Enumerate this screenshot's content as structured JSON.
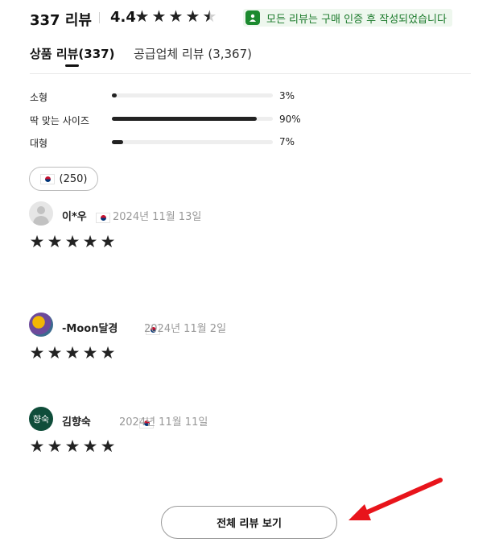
{
  "header": {
    "review_count_label": "337 리뷰",
    "rating": "4.4",
    "star_rating": 4.5,
    "verified_notice": "모든 리뷰는 구매 인증 후 작성되었습니다"
  },
  "tabs": [
    {
      "label": "상품 리뷰(337)",
      "active": true
    },
    {
      "label": "공급업체 리뷰 (3,367)",
      "active": false
    }
  ],
  "fit": [
    {
      "label": "소형",
      "percent": 3,
      "percent_label": "3%"
    },
    {
      "label": "딱 맞는 사이즈",
      "percent": 90,
      "percent_label": "90%"
    },
    {
      "label": "대형",
      "percent": 7,
      "percent_label": "7%"
    }
  ],
  "country_filter": {
    "flag": "south-korea-flag-icon",
    "count": "(250)"
  },
  "reviews": [
    {
      "name": "이*우",
      "date": "2024년 11월 13일",
      "stars": 5,
      "avatar": "default-avatar"
    },
    {
      "name": "-Moon달경",
      "date": "2024년 11월 2일",
      "stars": 5,
      "avatar": "photo-avatar"
    },
    {
      "name": "김향숙",
      "date": "2024년 11월 11일",
      "stars": 5,
      "avatar": "text-avatar",
      "avatar_text": "향숙"
    }
  ],
  "view_all_label": "전체 리뷰 보기",
  "colors": {
    "star": "#222222",
    "verified_green": "#1c8a2f",
    "annotation_arrow": "#e8141b"
  }
}
